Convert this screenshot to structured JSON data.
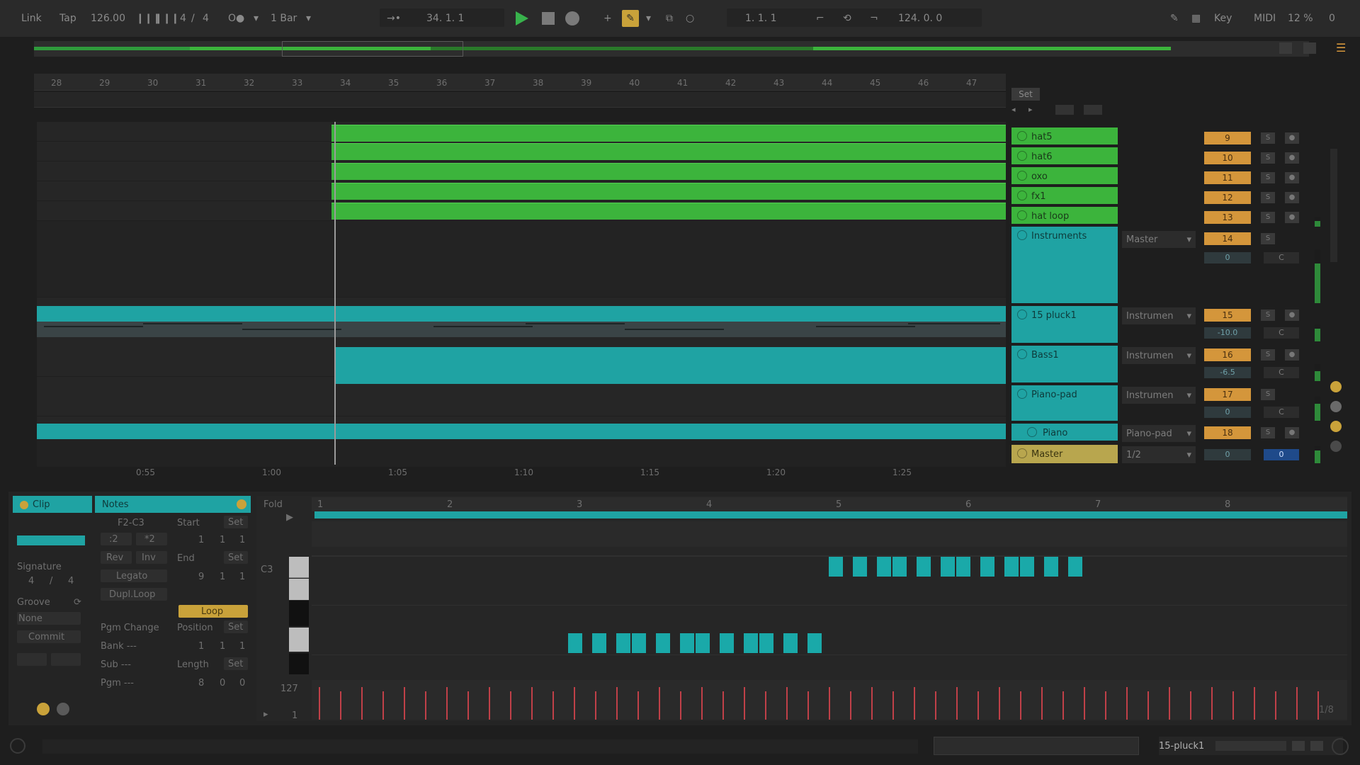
{
  "transport": {
    "link": "Link",
    "tap": "Tap",
    "tempo": "126.00",
    "signature_num": "4",
    "signature_sep": "/",
    "signature_den": "4",
    "quantize": "1 Bar",
    "position": "34.  1.  1",
    "loop_start": "1.  1.  1",
    "loop_length": "124.  0.  0",
    "key": "Key",
    "midi": "MIDI",
    "cpu": "12 %",
    "disk": "0"
  },
  "ruler": {
    "bars": [
      "28",
      "29",
      "30",
      "31",
      "32",
      "33",
      "34",
      "35",
      "36",
      "37",
      "38",
      "39",
      "40",
      "41",
      "42",
      "43",
      "44",
      "45",
      "46",
      "47"
    ],
    "set_label": "Set"
  },
  "time_ruler": [
    "0:55",
    "1:00",
    "1:05",
    "1:10",
    "1:15",
    "1:20",
    "1:25"
  ],
  "tracks": [
    {
      "name": "hat5",
      "number": "9",
      "color": "green"
    },
    {
      "name": "hat6",
      "number": "10",
      "color": "green"
    },
    {
      "name": "oxo",
      "number": "11",
      "color": "green"
    },
    {
      "name": "fx1",
      "number": "12",
      "color": "green"
    },
    {
      "name": "hat loop",
      "number": "13",
      "color": "green"
    },
    {
      "name": "Instruments",
      "number": "14",
      "color": "cyan",
      "output": "Master",
      "volume": "0",
      "pan": "C"
    },
    {
      "name": "15 pluck1",
      "number": "15",
      "color": "cyan",
      "output": "Instrumen",
      "volume": "-10.0",
      "pan": "C"
    },
    {
      "name": "Bass1",
      "number": "16",
      "color": "cyan",
      "output": "Instrumen",
      "volume": "-6.5",
      "pan": "C"
    },
    {
      "name": "Piano-pad",
      "number": "17",
      "color": "cyan",
      "output": "Instrumen",
      "volume": "0",
      "pan": "C"
    },
    {
      "name": "Piano",
      "number": "18",
      "color": "cyan",
      "output": "Piano-pad"
    }
  ],
  "master": {
    "name": "Master",
    "output": "1/2",
    "volume": "0",
    "pan": "0"
  },
  "track_buttons": {
    "solo": "S"
  },
  "clip_panel": {
    "clip_tab": "Clip",
    "notes_tab": "Notes",
    "range": "F2-C3",
    "start_label": "Start",
    "set": "Set",
    "div2": ":2",
    "mul2": "*2",
    "rev": "Rev",
    "inv": "Inv",
    "end_label": "End",
    "legato": "Legato",
    "dupl_loop": "Dupl.Loop",
    "loop": "Loop",
    "signature_label": "Signature",
    "sig_num": "4",
    "sig_sep": "/",
    "sig_den": "4",
    "groove_label": "Groove",
    "groove_value": "None",
    "commit": "Commit",
    "pgm_change": "Pgm Change",
    "position_label": "Position",
    "bank": "Bank ---",
    "sub": "Sub ---",
    "pgm": "Pgm ---",
    "length_label": "Length",
    "start_value": [
      "1",
      "1",
      "1"
    ],
    "end_value": [
      "9",
      "1",
      "1"
    ],
    "position_value": [
      "1",
      "1",
      "1"
    ],
    "length_value": [
      "8",
      "0",
      "0"
    ]
  },
  "piano_roll": {
    "fold": "Fold",
    "c3_label": "C3",
    "bars": [
      "1",
      "2",
      "3",
      "4",
      "5",
      "6",
      "7",
      "8"
    ],
    "vel_max": "127",
    "vel_min": "1",
    "grid": "1/8"
  },
  "footer": {
    "selected_track": "15-pluck1"
  },
  "colors": {
    "clip_green": "#3cb43c",
    "clip_cyan": "#1fa3a3",
    "track_number": "#d4963b",
    "master": "#b8a64e",
    "play": "#38b24c",
    "velocity": "#c04048"
  }
}
